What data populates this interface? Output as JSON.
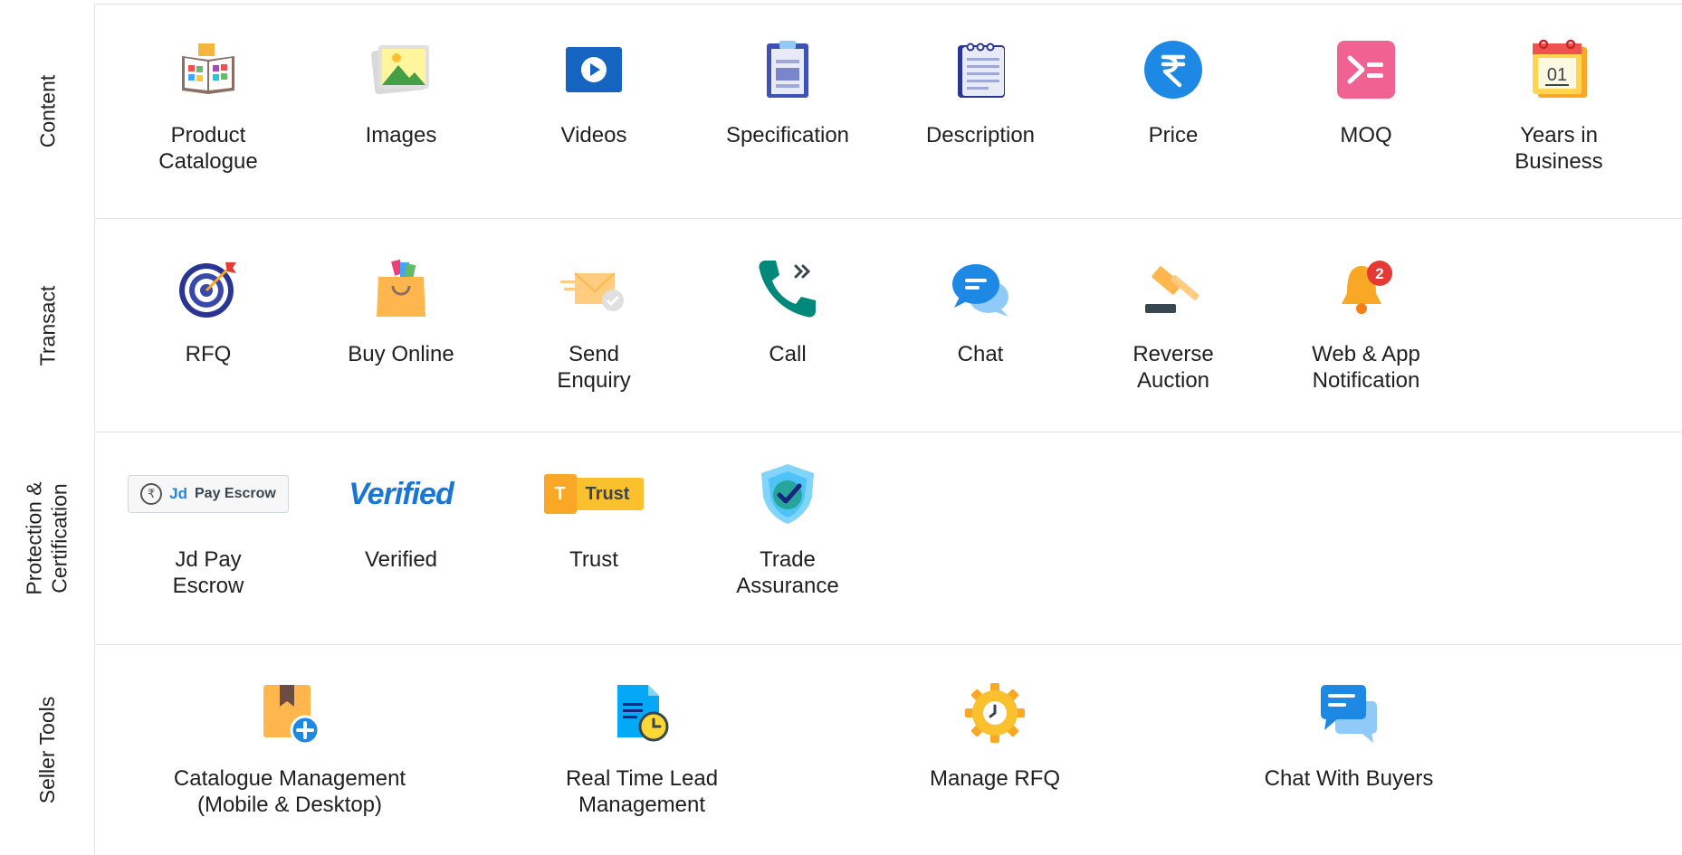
{
  "sections": [
    {
      "label": "Content",
      "items": [
        {
          "label": "Product\nCatalogue",
          "icon": "open-book-icon"
        },
        {
          "label": "Images",
          "icon": "photo-icon"
        },
        {
          "label": "Videos",
          "icon": "video-play-icon"
        },
        {
          "label": "Specification",
          "icon": "clipboard-icon"
        },
        {
          "label": "Description",
          "icon": "notepad-icon"
        },
        {
          "label": "Price",
          "icon": "rupee-icon"
        },
        {
          "label": "MOQ",
          "icon": "moq-icon"
        },
        {
          "label": "Years in\nBusiness",
          "icon": "calendar-icon",
          "calendar_text": "01"
        }
      ]
    },
    {
      "label": "Transact",
      "items": [
        {
          "label": "RFQ",
          "icon": "target-icon"
        },
        {
          "label": "Buy Online",
          "icon": "shopping-bag-icon"
        },
        {
          "label": "Send\nEnquiry",
          "icon": "send-envelope-icon"
        },
        {
          "label": "Call",
          "icon": "phone-icon"
        },
        {
          "label": "Chat",
          "icon": "chat-bubbles-icon"
        },
        {
          "label": "Reverse\nAuction",
          "icon": "gavel-icon"
        },
        {
          "label": "Web & App\nNotification",
          "icon": "bell-icon",
          "badge_count": "2"
        }
      ]
    },
    {
      "label": "Protection &\nCertification",
      "items": [
        {
          "label": "Jd Pay\nEscrow",
          "icon": "jd-pay-escrow-badge",
          "badge_jd": "Jd",
          "badge_text": "Pay Escrow"
        },
        {
          "label": "Verified",
          "icon": "verified-badge",
          "badge_text": "Verified"
        },
        {
          "label": "Trust",
          "icon": "trust-badge",
          "badge_text": "Trust"
        },
        {
          "label": "Trade\nAssurance",
          "icon": "shield-check-icon"
        }
      ]
    },
    {
      "label": "Seller Tools",
      "items": [
        {
          "label": "Catalogue Management\n(Mobile & Desktop)",
          "icon": "catalogue-add-icon"
        },
        {
          "label": "Real Time Lead\nManagement",
          "icon": "document-clock-icon"
        },
        {
          "label": "Manage RFQ",
          "icon": "gear-clock-icon"
        },
        {
          "label": "Chat With Buyers",
          "icon": "chat-buyers-icon"
        }
      ]
    }
  ],
  "colors": {
    "text": "#1f1f1f",
    "divider": "#e3e3e3",
    "blue": "#1e88e5",
    "pink": "#f06292",
    "amber": "#f7b733"
  }
}
